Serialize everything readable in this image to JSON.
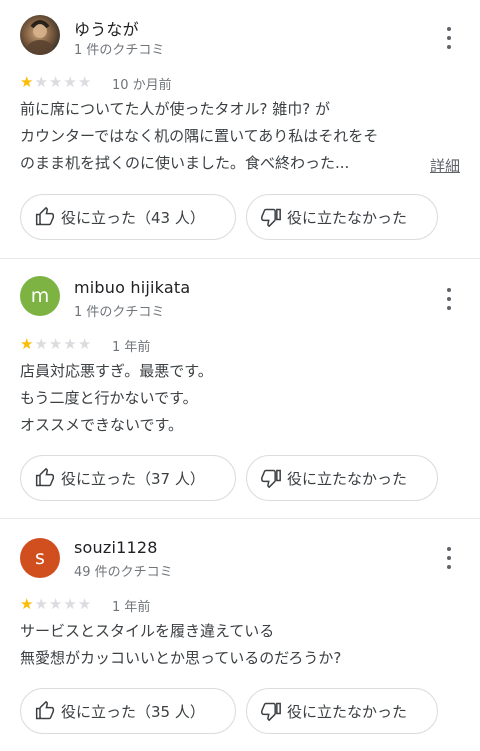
{
  "reviews": [
    {
      "author": "ゆうなが",
      "review_count": "1 件のクチコミ",
      "rating": 1,
      "date": "10 か月前",
      "text_lines": [
        "前に席についてた人が使ったタオル? 雑巾? が",
        "カウンターではなく机の隅に置いてあり私はそれをそ",
        "のまま机を拭くのに使いました。食べ終わった..."
      ],
      "more_label": "詳細",
      "helpful_label": "役に立った（43 人）",
      "not_helpful_label": "役に立たなかった",
      "avatar_icon": "user-photo"
    },
    {
      "author": "mibuo hijikata",
      "review_count": "1 件のクチコミ",
      "rating": 1,
      "date": "1 年前",
      "text_lines": [
        "店員対応悪すぎ。最悪です。",
        "もう二度と行かないです。",
        "オススメできないです。"
      ],
      "helpful_label": "役に立った（37 人）",
      "not_helpful_label": "役に立たなかった",
      "avatar_letter": "m",
      "avatar_color": "#7cb342"
    },
    {
      "author": "souzi1128",
      "review_count": "49 件のクチコミ",
      "rating": 1,
      "date": "1 年前",
      "text_lines": [
        "サービスとスタイルを履き違えている",
        "無愛想がカッコいいとか思っているのだろうか?"
      ],
      "helpful_label": "役に立った（35 人）",
      "not_helpful_label": "役に立たなかった",
      "avatar_letter": "s",
      "avatar_color": "#d14f1f"
    }
  ],
  "colors": {
    "star_on": "#fbbc04",
    "star_off": "#dadce0"
  },
  "icons": {
    "more": "more-vert-icon",
    "helpful": "thumb-up-icon",
    "not_helpful": "thumb-down-icon",
    "star": "star-icon"
  }
}
